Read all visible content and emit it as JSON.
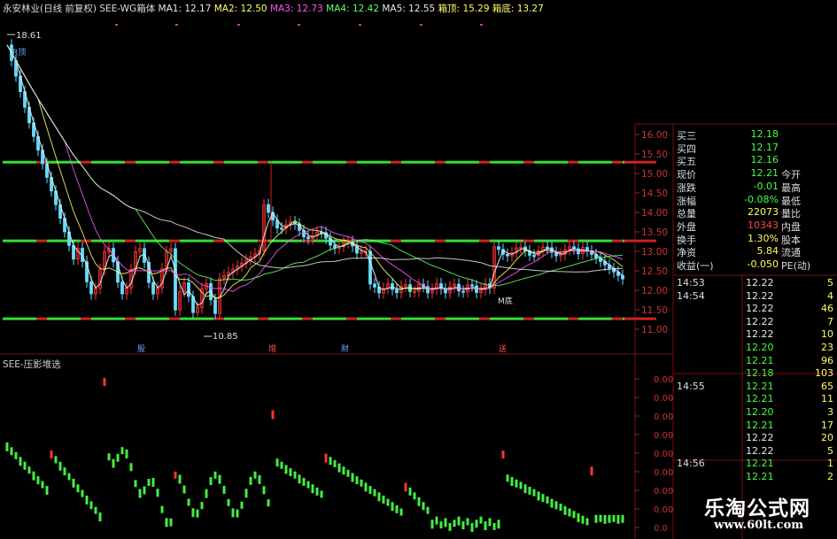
{
  "header": {
    "stock_title": "永安林业(日线 前复权)",
    "indicator_name": "SEE-WG箱体",
    "ma": [
      {
        "label": "MA1: 12.17",
        "color": "#e8e8e8"
      },
      {
        "label": "MA2: 12.50",
        "color": "#ffff66"
      },
      {
        "label": "MA3: 12.73",
        "color": "#ff55ff"
      },
      {
        "label": "MA4: 12.42",
        "color": "#66ff66"
      },
      {
        "label": "MA5: 12.55",
        "color": "#e8e8e8"
      }
    ],
    "box_top": {
      "label": "箱顶: 15.29",
      "color": "#ffff66"
    },
    "box_bottom": {
      "label": "箱底: 13.27",
      "color": "#ffff66"
    }
  },
  "indicator": {
    "title": "SEE-压影堆选"
  },
  "markers": {
    "high_label": "18.61",
    "low_label": "10.85",
    "r_top": "R顶",
    "m_bottom": "M底",
    "events": [
      "股",
      "增",
      "财",
      "送"
    ]
  },
  "chart_data": {
    "type": "candlestick",
    "price_axis": [
      16.0,
      15.5,
      15.0,
      14.5,
      14.0,
      13.5,
      13.0,
      12.5,
      12.0,
      11.5,
      11.0
    ],
    "price_axis_labels": [
      "16.00",
      "15.50",
      "15.00",
      "14.50",
      "14.00",
      "13.50",
      "13.00",
      "12.50",
      "12.00",
      "11.50",
      "11.00"
    ],
    "box_lines": [
      15.29,
      13.27,
      11.27
    ],
    "indicator_axis_labels": [
      "0.00",
      "0.00",
      "0.00",
      "0.00",
      "0.00",
      "0.00",
      "0.00",
      "0.00",
      "0.0"
    ],
    "colors": {
      "up": "#ff3333",
      "down": "#66ddff",
      "box_line": "#33dd33",
      "indicator_up": "#ff3333",
      "indicator_down": "#44ee44"
    }
  },
  "quote": {
    "rows": [
      {
        "label": "买三",
        "value": "12.18",
        "color": "#44ff44",
        "label2": ""
      },
      {
        "label": "买四",
        "value": "12.17",
        "color": "#44ff44",
        "label2": ""
      },
      {
        "label": "买五",
        "value": "12.16",
        "color": "#44ff44",
        "label2": ""
      },
      {
        "label": "现价",
        "value": "12.21",
        "color": "#44ff44",
        "label2": "今开"
      },
      {
        "label": "涨跌",
        "value": "-0.01",
        "color": "#44ff44",
        "label2": "最高"
      },
      {
        "label": "涨幅",
        "value": "-0.08%",
        "color": "#44ff44",
        "label2": "最低"
      },
      {
        "label": "总量",
        "value": "22073",
        "color": "#ffff66",
        "label2": "量比"
      },
      {
        "label": "外盘",
        "value": "10343",
        "color": "#ff4444",
        "label2": "内盘"
      },
      {
        "label": "换手",
        "value": "1.30%",
        "color": "#ffff66",
        "label2": "股本"
      },
      {
        "label": "净资",
        "value": "5.84",
        "color": "#ffff66",
        "label2": "流通"
      },
      {
        "label": "收益(一)",
        "value": "-0.050",
        "color": "#ffff66",
        "label2": "PE(动)"
      }
    ]
  },
  "ticks": [
    {
      "time": "14:53",
      "price": "12.22",
      "vol": "5"
    },
    {
      "time": "14:54",
      "price": "12.22",
      "vol": "4"
    },
    {
      "time": "",
      "price": "12.22",
      "vol": "46"
    },
    {
      "time": "",
      "price": "12.22",
      "vol": "7"
    },
    {
      "time": "",
      "price": "12.22",
      "vol": "10"
    },
    {
      "time": "",
      "price": "12.20",
      "vol": "23"
    },
    {
      "time": "",
      "price": "12.21",
      "vol": "96"
    },
    {
      "time": "",
      "price": "12.18",
      "vol": "103"
    },
    {
      "time": "14:55",
      "price": "12.21",
      "vol": "65"
    },
    {
      "time": "",
      "price": "12.21",
      "vol": "11"
    },
    {
      "time": "",
      "price": "12.20",
      "vol": "3"
    },
    {
      "time": "",
      "price": "12.21",
      "vol": "17"
    },
    {
      "time": "",
      "price": "12.22",
      "vol": "20"
    },
    {
      "time": "",
      "price": "12.22",
      "vol": "5"
    },
    {
      "time": "14:56",
      "price": "12.21",
      "vol": "1"
    },
    {
      "time": "",
      "price": "12.21",
      "vol": "2"
    }
  ],
  "watermark": {
    "cn": "乐淘公式网",
    "url": "www.60lt.com"
  }
}
